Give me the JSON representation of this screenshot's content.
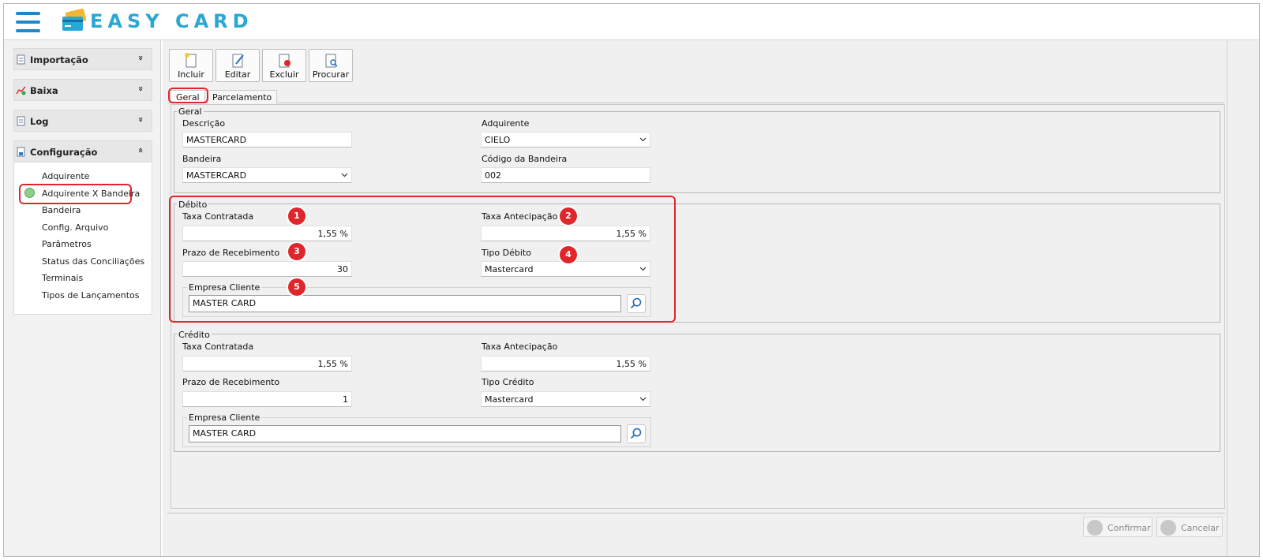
{
  "app": {
    "title": "EASY CARD"
  },
  "sidebar": {
    "sections": [
      {
        "label": "Importação",
        "chevron": "»"
      },
      {
        "label": "Baixa",
        "chevron": "»"
      },
      {
        "label": "Log",
        "chevron": "»"
      },
      {
        "label": "Configuração",
        "chevron": "«"
      }
    ],
    "items": [
      "Adquirente",
      "Adquirente X Bandeira",
      "Bandeira",
      "Config. Arquivo",
      "Parâmetros",
      "Status das Conciliações",
      "Terminais",
      "Tipos de Lançamentos"
    ],
    "selected_index": 1
  },
  "toolbar": {
    "incluir": "Incluir",
    "editar": "Editar",
    "excluir": "Excluir",
    "procurar": "Procurar"
  },
  "tabs": [
    "Geral",
    "Parcelamento"
  ],
  "geral": {
    "title": "Geral",
    "descricao_label": "Descrição",
    "descricao_value": "MASTERCARD",
    "adquirente_label": "Adquirente",
    "adquirente_value": "CIELO",
    "bandeira_label": "Bandeira",
    "bandeira_value": "MASTERCARD",
    "codigo_label": "Código da Bandeira",
    "codigo_value": "002"
  },
  "debito": {
    "title": "Débito",
    "taxa_contratada_label": "Taxa Contratada",
    "taxa_contratada_value": "1,55 %",
    "taxa_antecipacao_label": "Taxa Antecipação",
    "taxa_antecipacao_value": "1,55 %",
    "prazo_label": "Prazo de Recebimento",
    "prazo_value": "30",
    "tipo_label": "Tipo Débito",
    "tipo_value": "Mastercard",
    "empresa_label": "Empresa Cliente",
    "empresa_value": "MASTER CARD"
  },
  "credito": {
    "title": "Crédito",
    "taxa_contratada_label": "Taxa Contratada",
    "taxa_contratada_value": "1,55 %",
    "taxa_antecipacao_label": "Taxa Antecipação",
    "taxa_antecipacao_value": "1,55 %",
    "prazo_label": "Prazo de Recebimento",
    "prazo_value": "1",
    "tipo_label": "Tipo Crédito",
    "tipo_value": "Mastercard",
    "empresa_label": "Empresa Cliente",
    "empresa_value": "MASTER CARD"
  },
  "annotations": [
    "1",
    "2",
    "3",
    "4",
    "5"
  ],
  "actions": {
    "confirmar": "Confirmar",
    "cancelar": "Cancelar"
  },
  "colors": {
    "accent": "#1e88c9",
    "highlight": "#e0262b",
    "logo": "#2aa7d3"
  },
  "icons": {
    "menu": "hamburger-icon",
    "logo": "credit-card-icon",
    "search": "magnifier-icon",
    "check": "check-circle-icon",
    "dropdown": "chevron-down-icon"
  }
}
